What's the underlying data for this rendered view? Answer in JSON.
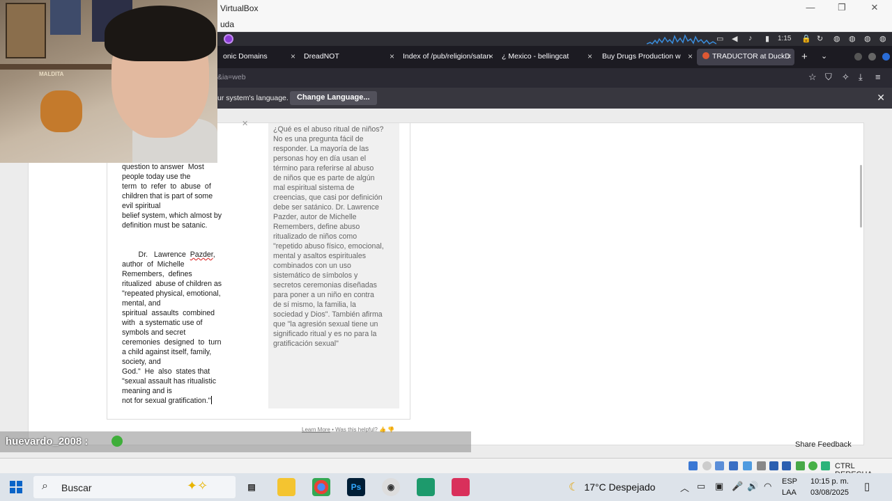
{
  "window": {
    "title": "VirtualBox",
    "menu": "uda",
    "min": "—",
    "restore": "❐",
    "close": "✕"
  },
  "guest_panel": {
    "time": "1:15"
  },
  "tabs": [
    {
      "label": "onic Domains",
      "active": false
    },
    {
      "label": "DreadNOT",
      "active": false
    },
    {
      "label": "Index of /pub/religion/satan",
      "active": false
    },
    {
      "label": "¿ Mexico - bellingcat",
      "active": false
    },
    {
      "label": "Buy Drugs Production w",
      "active": false
    },
    {
      "label": "TRADUCTOR at DuckD",
      "active": true
    }
  ],
  "tab_close": "×",
  "new_tab": "+",
  "url": {
    "text": "&ia=web"
  },
  "notification": {
    "message": "ur system's language.",
    "button": "Change Language...",
    "close": "✕"
  },
  "translator": {
    "clear": "✕",
    "source_lines": [
      "question to answer  Most",
      "people today use the",
      "term  to  refer  to  abuse  of",
      "children that is part of some",
      "evil spiritual",
      "belief system, which almost by",
      "definition must be satanic.",
      "",
      "",
      "        Dr.   Lawrence  ",
      "author  of  Michelle",
      "Remembers,  defines",
      "ritualized  abuse of children as",
      "\"repeated physical, emotional,",
      "mental, and",
      "spiritual  assaults  combined",
      "with  a systematic use of",
      "symbols and secret",
      "ceremonies  designed  to  turn",
      "a child against itself, family,",
      "society, and",
      "God.\"  He  also  states that",
      "\"sexual assault has ritualistic",
      "meaning and is",
      "not for sexual gratification.\""
    ],
    "source_name": "Pazder",
    "source_name_after": ",",
    "output_text": "¿Qué es el abuso ritual de niños?\nNo es una pregunta fácil de\nresponder. La mayoría de las\npersonas hoy en día usan el\ntérmino para referirse al abuso\nde niños que es parte de algún\nmal espiritual sistema de\ncreencias, que casi por definición\ndebe ser satánico. Dr. Lawrence\nPazder, autor de Michelle\nRemembers, define abuso\nritualizado de niños como\n\"repetido abuso físico, emocional,\nmental y asaltos espirituales\ncombinados con un uso\nsistemático de símbolos y\nsecretos ceremonias diseñadas\npara poner a un niño en contra\nde sí mismo, la familia, la\nsociedad y Dios\". También afirma\nque \"la agresión sexual tiene un\nsignificado ritual y es no para la\ngratificación sexual\"",
    "learn_more": "Learn More",
    "helpful": " • Was this helpful?",
    "thumbs_up": "👍",
    "thumbs_down": "👎",
    "share_feedback": "Share Feedback"
  },
  "webcam": {
    "label": "MALDITA"
  },
  "chat": {
    "user": "huevardo_2008 :"
  },
  "vbox_status": {
    "host_key": "CTRL DERECHA"
  },
  "taskbar": {
    "search_placeholder": "Buscar",
    "weather": "17°C  Despejado",
    "lang_top": "ESP",
    "lang_bottom": "LAA",
    "time": "10:15 p. m.",
    "date": "03/08/2025",
    "ps_label": "Ps"
  },
  "colors": {
    "accent_tab": "#42414d",
    "duck": "#de5833",
    "tor": "#8b3bd6"
  }
}
